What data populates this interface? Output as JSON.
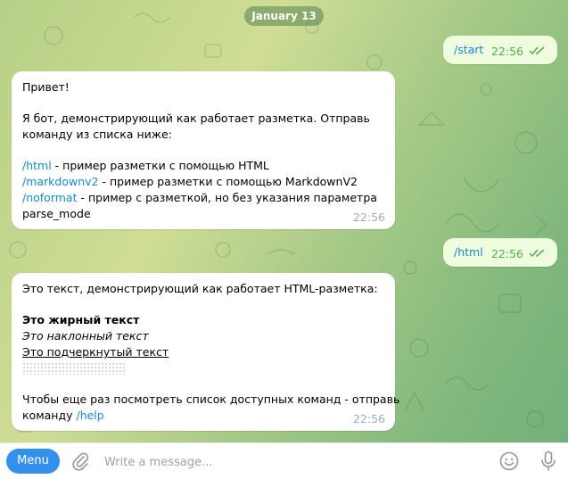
{
  "date_label": "January 13",
  "messages": {
    "start": {
      "text": "/start",
      "time": "22:56"
    },
    "welcome": {
      "greeting": "Привет!",
      "intro_1": "Я бот, демонстрирующий как работает разметка. Отправь",
      "intro_2": "команду из списка ниже:",
      "cmd_html": "/html",
      "cmd_html_desc": " - пример разметки с помощью HTML",
      "cmd_md": "/markdownv2",
      "cmd_md_desc": " - пример разметки с помощью MarkdownV2",
      "cmd_noformat": "/noformat",
      "cmd_noformat_desc": " - пример с разметкой, но без указания параметра",
      "cmd_noformat_desc2": "parse_mode",
      "time": "22:56"
    },
    "html_cmd": {
      "text": "/html",
      "time": "22:56"
    },
    "html_demo": {
      "intro": "Это текст, демонстрирующий как работает HTML-разметка:",
      "bold": "Это жирный текст",
      "italic": "Это наклонный текст",
      "underline": "Это подчеркнутый текст",
      "outro_1": "Чтобы еще раз посмотреть список доступных команд - отправь",
      "outro_2": "команду ",
      "cmd_help": "/help",
      "time": "22:56"
    }
  },
  "composer": {
    "menu_label": "Menu",
    "placeholder": "Write a message...",
    "attach_icon": "paperclip-icon",
    "emoji_icon": "smile-icon",
    "mic_icon": "microphone-icon"
  },
  "colors": {
    "accent": "#3390ec",
    "link": "#168acd",
    "outgoing_bubble": "#effdde",
    "read_check": "#4fae4e",
    "time_gray": "#a0acb6"
  }
}
